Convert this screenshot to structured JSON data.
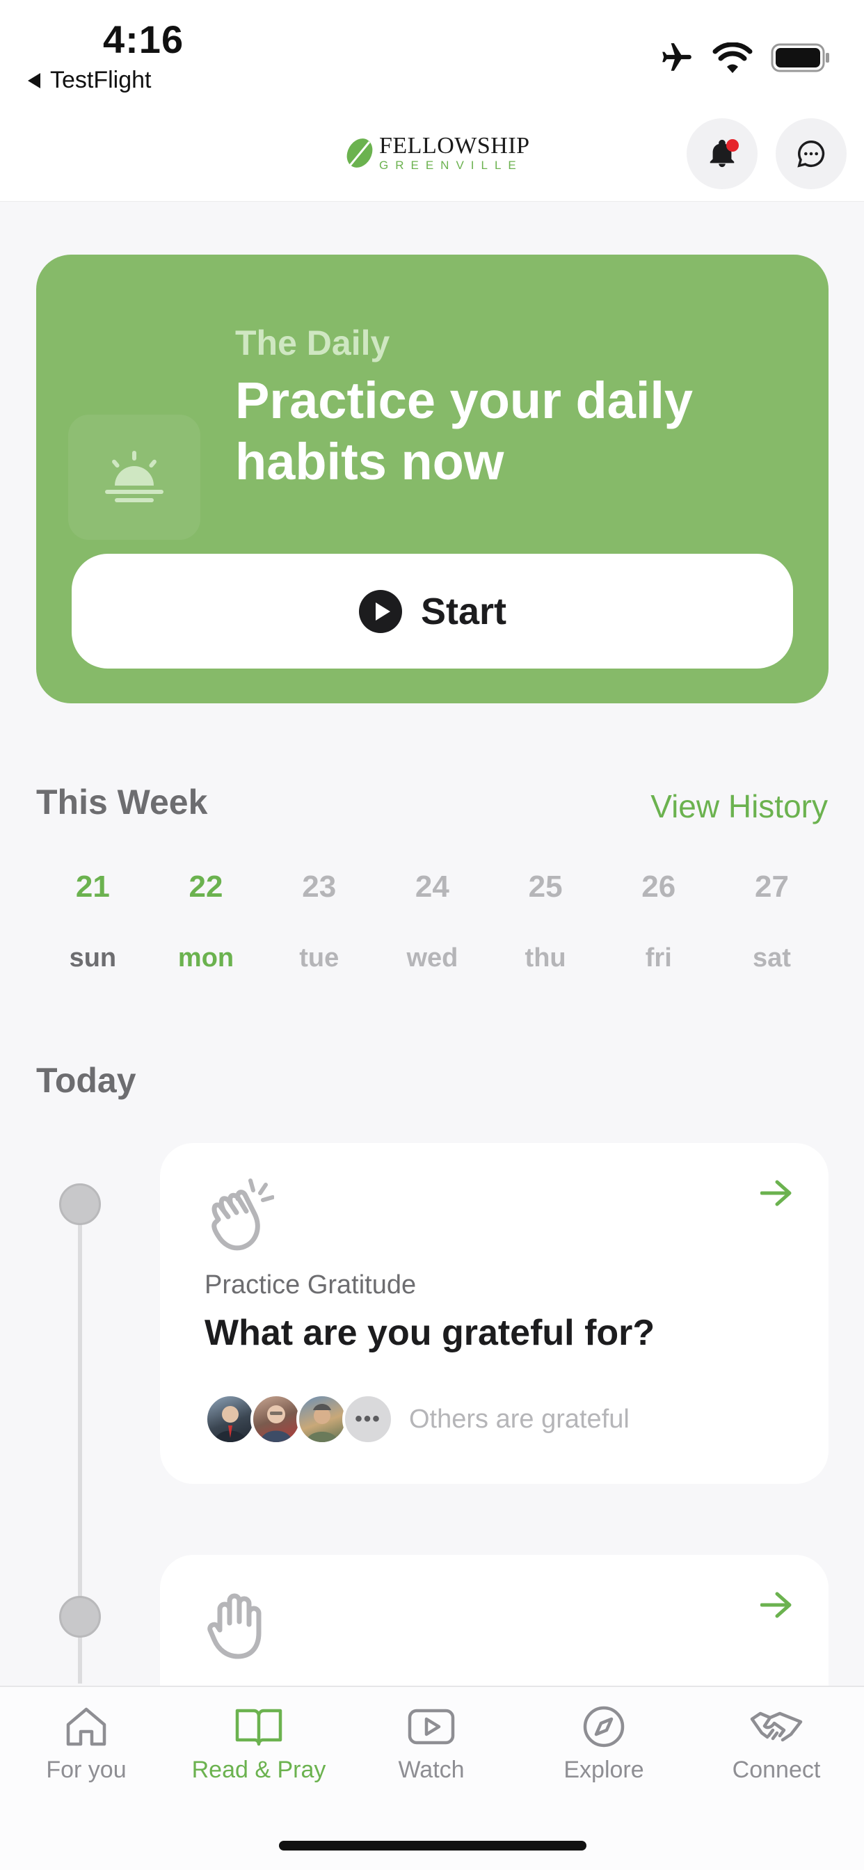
{
  "status_bar": {
    "time": "4:16",
    "back_label": "TestFlight"
  },
  "header": {
    "logo_main": "FELLOWSHIP",
    "logo_sub": "GREENVILLE",
    "notification_dot_color": "#e5242b"
  },
  "hero": {
    "subtitle": "The Daily",
    "title": "Practice your daily habits now",
    "button_label": "Start",
    "background_color": "#86ba69",
    "icon": "sunrise-icon"
  },
  "week": {
    "title": "This Week",
    "view_history_label": "View History",
    "days": [
      {
        "num": "21",
        "name": "sun",
        "state": "done"
      },
      {
        "num": "22",
        "name": "mon",
        "state": "current"
      },
      {
        "num": "23",
        "name": "tue",
        "state": "upcoming"
      },
      {
        "num": "24",
        "name": "wed",
        "state": "upcoming"
      },
      {
        "num": "25",
        "name": "thu",
        "state": "upcoming"
      },
      {
        "num": "26",
        "name": "fri",
        "state": "upcoming"
      },
      {
        "num": "27",
        "name": "sat",
        "state": "upcoming"
      }
    ]
  },
  "today": {
    "title": "Today",
    "cards": [
      {
        "icon": "clapping-hands-icon",
        "category": "Practice Gratitude",
        "title": "What are you grateful for?",
        "others_label": "Others are grateful",
        "avatars": [
          "avatar-1",
          "avatar-2",
          "avatar-3",
          "more-avatars"
        ]
      },
      {
        "icon": "raised-hand-icon"
      }
    ]
  },
  "tabbar": {
    "tabs": [
      {
        "label": "For you",
        "icon": "home-icon",
        "active": false
      },
      {
        "label": "Read & Pray",
        "icon": "open-book-icon",
        "active": true
      },
      {
        "label": "Watch",
        "icon": "play-video-icon",
        "active": false
      },
      {
        "label": "Explore",
        "icon": "compass-icon",
        "active": false
      },
      {
        "label": "Connect",
        "icon": "handshake-icon",
        "active": false
      }
    ]
  },
  "colors": {
    "accent": "#6bb24f",
    "muted": "#b5b5b8",
    "dark": "#1c1c1e"
  }
}
